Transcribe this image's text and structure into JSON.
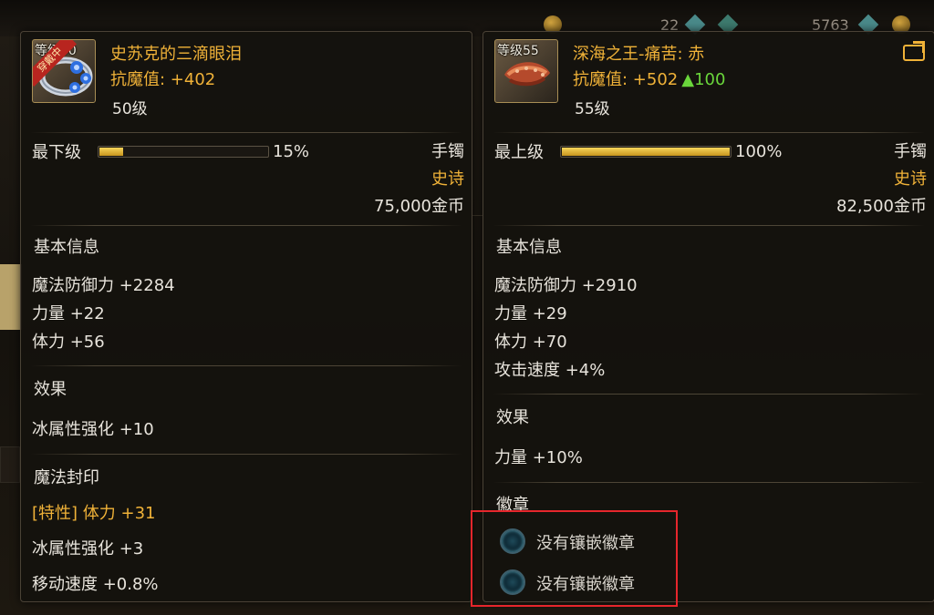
{
  "background": {
    "currency_a": "22",
    "currency_b": "5763"
  },
  "left_item": {
    "level_badge": "等级50",
    "equipped_tag": "穿戴中",
    "name": "史苏克的三滴眼泪",
    "stat_line": "抗魔值: +402",
    "level": "50级",
    "grade_label": "最下级",
    "grade_percent": 15,
    "grade_percent_text": "15%",
    "type": "手镯",
    "rarity": "史诗",
    "price": "75,000金币",
    "basic_info_header": "基本信息",
    "basic_stats": [
      "魔法防御力 +2284",
      "力量 +22",
      "体力 +56"
    ],
    "effects_header": "效果",
    "effects": [
      "冰属性强化 +10"
    ],
    "seal_header": "魔法封印",
    "seal_trait": "[特性] 体力 +31",
    "seal_stats": [
      "冰属性强化 +3",
      "移动速度 +0.8%"
    ]
  },
  "right_item": {
    "level_badge": "等级55",
    "name": "深海之王-痛苦: 赤",
    "stat_line": "抗魔值: +502",
    "stat_delta": "▲100",
    "level": "55级",
    "grade_label": "最上级",
    "grade_percent": 100,
    "grade_percent_text": "100%",
    "type": "手镯",
    "rarity": "史诗",
    "price": "82,500金币",
    "basic_info_header": "基本信息",
    "basic_stats": [
      "魔法防御力 +2910",
      "力量 +29",
      "体力 +70",
      "攻击速度 +4%"
    ],
    "effects_header": "效果",
    "effects": [
      "力量 +10%"
    ],
    "emblem_header": "徽章",
    "emblem_slots": [
      "没有镶嵌徽章",
      "没有镶嵌徽章"
    ]
  },
  "colors": {
    "gold": "#f0b238",
    "increase": "#6ad63b",
    "highlight": "#e6262c"
  },
  "icons": {
    "left_item": "ice-bracelet-icon",
    "right_item": "red-tentacle-bracelet-icon",
    "share": "share-icon",
    "emblem_slot": "empty-emblem-socket-icon"
  }
}
